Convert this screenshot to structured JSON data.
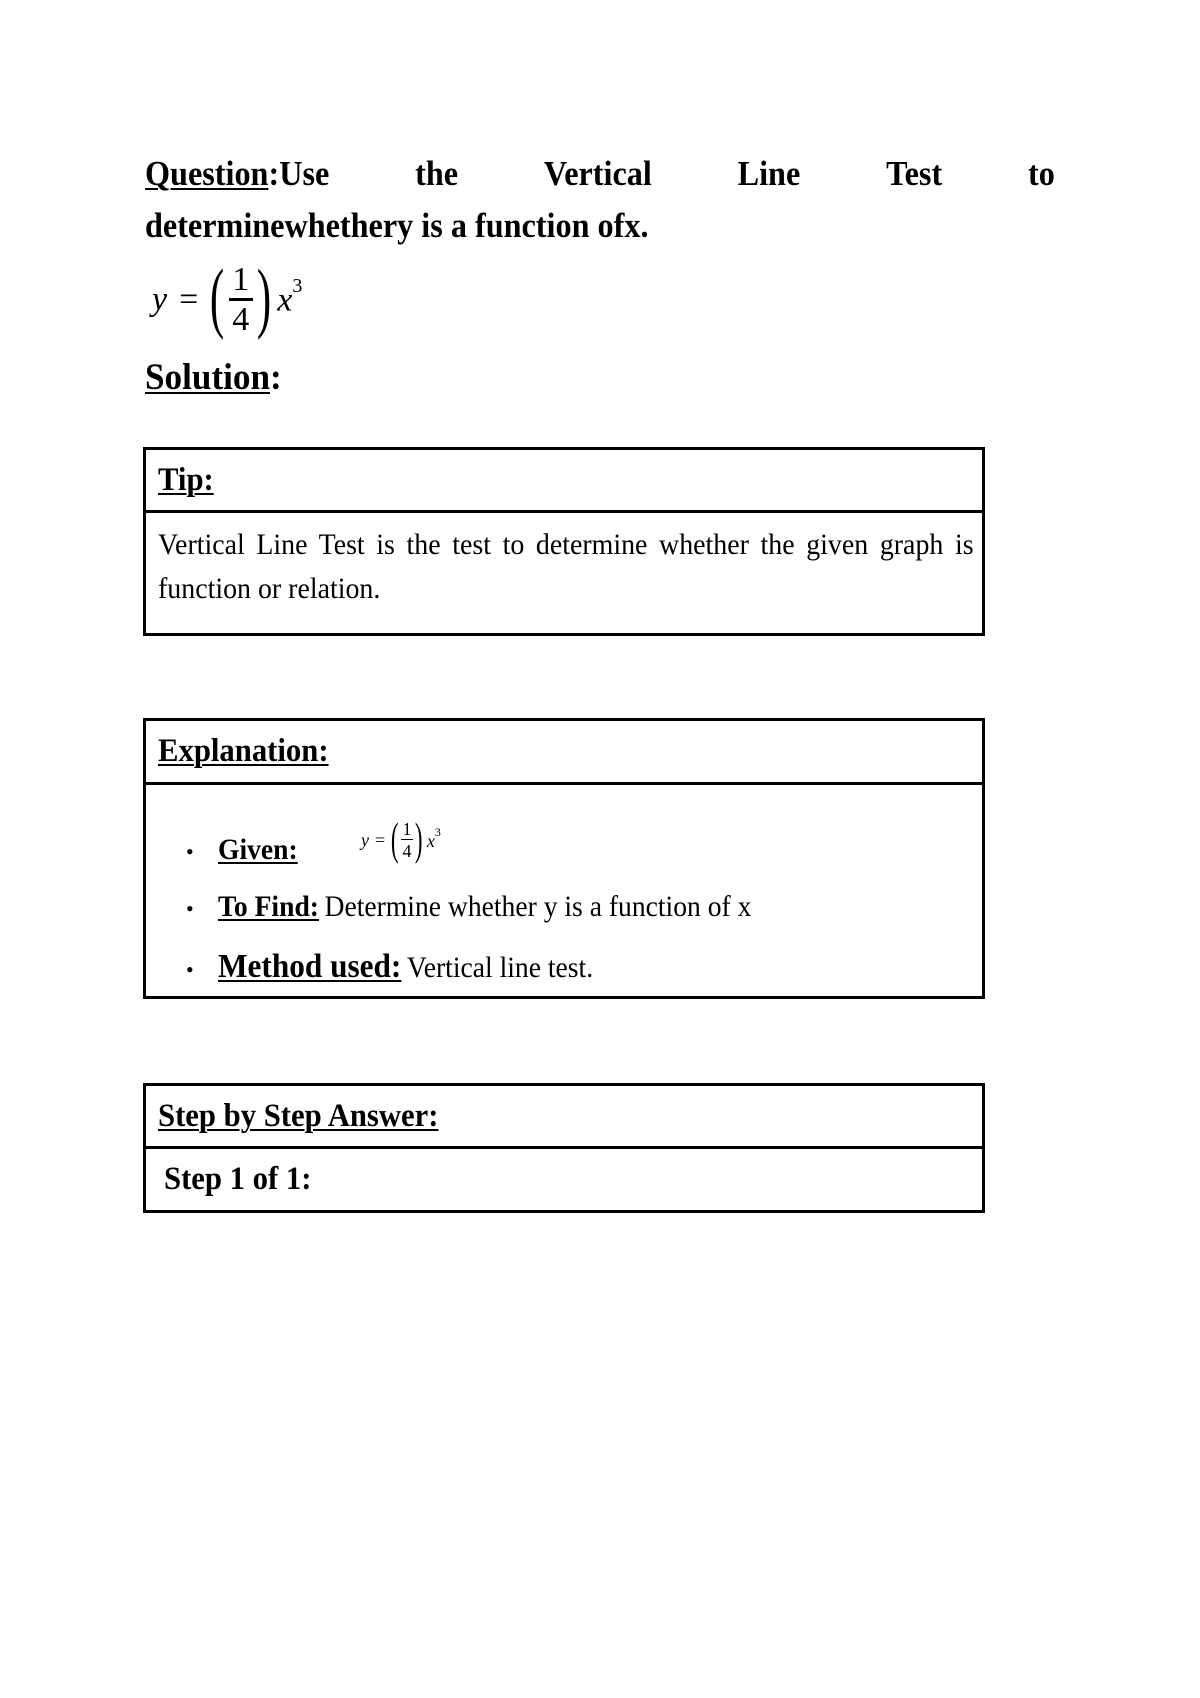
{
  "question": {
    "label": "Question",
    "colon": ":",
    "line1_words": [
      "Use",
      "the",
      "Vertical",
      "Line",
      "Test",
      "to"
    ],
    "line2": "determinewhethery is a function ofx."
  },
  "equation": {
    "lhs": "y",
    "equals": "=",
    "numerator": "1",
    "denominator": "4",
    "variable": "x",
    "exponent": "3",
    "open_paren": "(",
    "close_paren": ")"
  },
  "solution": {
    "label": "Solution",
    "colon": ":"
  },
  "tip": {
    "title": "Tip:",
    "body": "Vertical Line Test is the test to determine whether the given graph is function or relation."
  },
  "explanation": {
    "title": "Explanation:",
    "bullet_glyph": "•",
    "items": [
      {
        "label": "Given:",
        "text": ""
      },
      {
        "label": "To Find:",
        "text": "Determine whether y is a function of x"
      },
      {
        "label": "Method used:",
        "text": "Vertical line test."
      }
    ]
  },
  "step_by_step": {
    "title": "Step by Step Answer:",
    "step_label": "Step 1 of 1:"
  }
}
